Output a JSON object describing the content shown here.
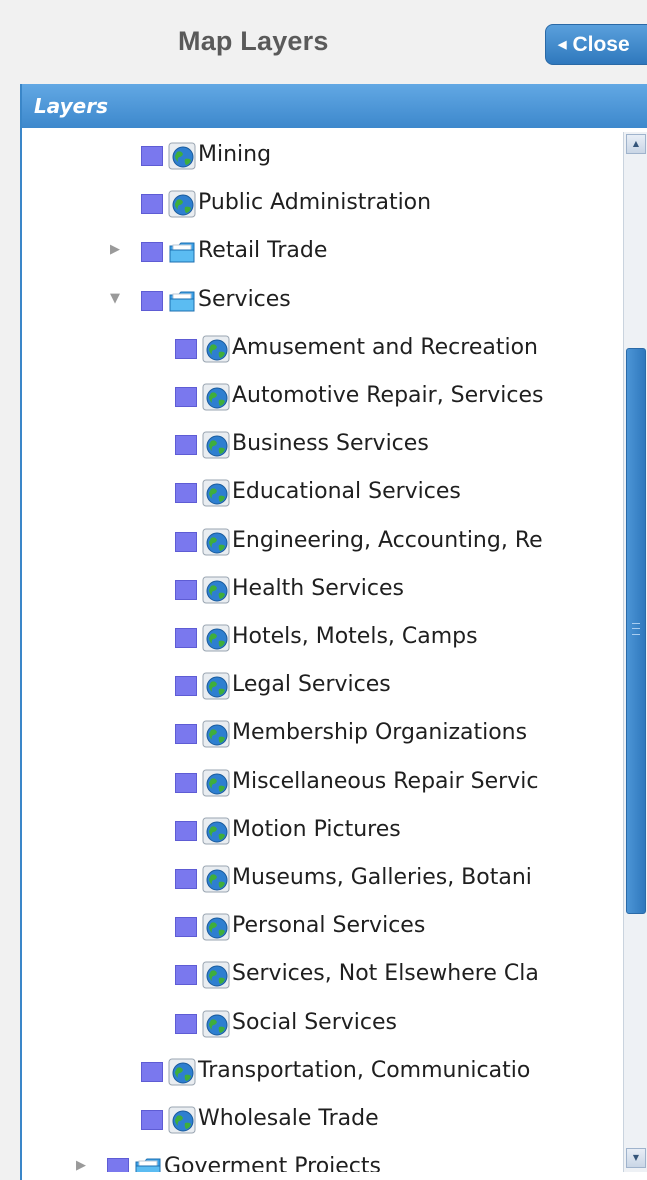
{
  "header": {
    "title": "Map Layers",
    "close_label": "Close"
  },
  "panel": {
    "title": "Layers"
  },
  "colors": {
    "accent": "#3d88cc",
    "swatch": "#7a78ee"
  },
  "tree": {
    "items": [
      {
        "label": "Mining",
        "level": 2,
        "type": "layer",
        "expander": "none"
      },
      {
        "label": "Public Administration",
        "level": 2,
        "type": "layer",
        "expander": "none"
      },
      {
        "label": "Retail Trade",
        "level": 2,
        "type": "folder",
        "expander": "collapsed"
      },
      {
        "label": "Services",
        "level": 2,
        "type": "folder",
        "expander": "expanded"
      },
      {
        "label": "Amusement and Recreation",
        "level": 3,
        "type": "layer",
        "expander": "none"
      },
      {
        "label": "Automotive Repair, Services",
        "level": 3,
        "type": "layer",
        "expander": "none"
      },
      {
        "label": "Business Services",
        "level": 3,
        "type": "layer",
        "expander": "none"
      },
      {
        "label": "Educational Services",
        "level": 3,
        "type": "layer",
        "expander": "none"
      },
      {
        "label": "Engineering, Accounting, Re",
        "level": 3,
        "type": "layer",
        "expander": "none"
      },
      {
        "label": "Health Services",
        "level": 3,
        "type": "layer",
        "expander": "none"
      },
      {
        "label": "Hotels, Motels, Camps",
        "level": 3,
        "type": "layer",
        "expander": "none"
      },
      {
        "label": "Legal Services",
        "level": 3,
        "type": "layer",
        "expander": "none"
      },
      {
        "label": "Membership Organizations",
        "level": 3,
        "type": "layer",
        "expander": "none"
      },
      {
        "label": "Miscellaneous Repair Servic",
        "level": 3,
        "type": "layer",
        "expander": "none"
      },
      {
        "label": "Motion Pictures",
        "level": 3,
        "type": "layer",
        "expander": "none"
      },
      {
        "label": "Museums, Galleries, Botani",
        "level": 3,
        "type": "layer",
        "expander": "none"
      },
      {
        "label": "Personal Services",
        "level": 3,
        "type": "layer",
        "expander": "none"
      },
      {
        "label": "Services, Not Elsewhere Cla",
        "level": 3,
        "type": "layer",
        "expander": "none"
      },
      {
        "label": "Social Services",
        "level": 3,
        "type": "layer",
        "expander": "none"
      },
      {
        "label": "Transportation, Communicatio",
        "level": 2,
        "type": "layer",
        "expander": "none"
      },
      {
        "label": "Wholesale Trade",
        "level": 2,
        "type": "layer",
        "expander": "none"
      },
      {
        "label": "Goverment Projects",
        "level": 1,
        "type": "folder",
        "expander": "collapsed"
      }
    ]
  }
}
